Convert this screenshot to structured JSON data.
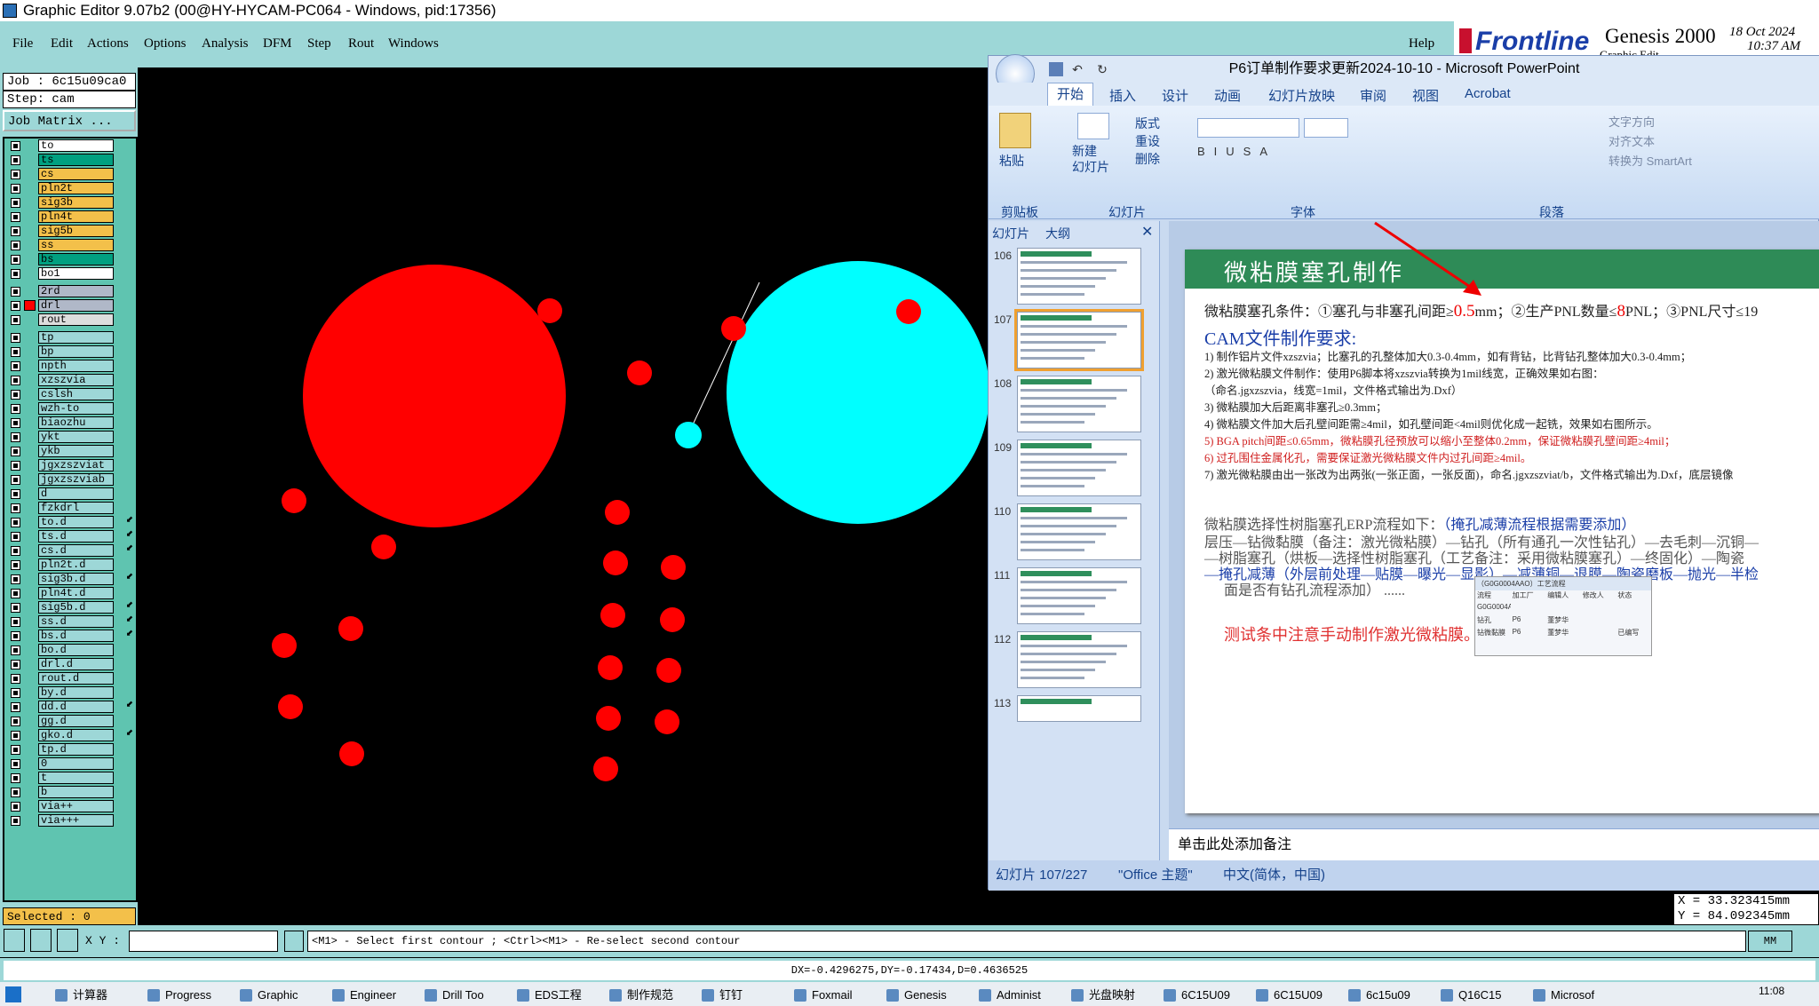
{
  "window": {
    "title": "Graphic Editor 9.07b2 (00@HY-HYCAM-PC064 - Windows, pid:17356)"
  },
  "menubar": {
    "items": [
      "File",
      "Edit",
      "Actions",
      "Options",
      "Analysis",
      "DFM",
      "Step",
      "Rout",
      "Windows"
    ],
    "help": "Help"
  },
  "banner": {
    "brand": "Frontline",
    "product": "Genesis 2000",
    "date": "18 Oct 2024",
    "time": "10:37 AM",
    "subtitle": "Graphic Edit"
  },
  "jobinfo": {
    "job": "Job : 6c15u09ca0",
    "step": "Step: cam",
    "matrix": "Job Matrix ..."
  },
  "layers": [
    {
      "name": "to",
      "color": "#ffffff"
    },
    {
      "name": "ts",
      "color": "#00a080"
    },
    {
      "name": "cs",
      "color": "#f3c04a"
    },
    {
      "name": "pln2t",
      "color": "#f3c04a"
    },
    {
      "name": "sig3b",
      "color": "#f3c04a"
    },
    {
      "name": "pln4t",
      "color": "#f3c04a"
    },
    {
      "name": "sig5b",
      "color": "#f3c04a"
    },
    {
      "name": "ss",
      "color": "#f3c04a"
    },
    {
      "name": "bs",
      "color": "#00a080"
    },
    {
      "name": "bo1",
      "color": "#ffffff"
    },
    {
      "name": "2rd",
      "color": "#b0b8c8"
    },
    {
      "name": "drl",
      "color": "#b0b8c8"
    },
    {
      "name": "rout",
      "color": "#dddddd"
    },
    {
      "name": "tp",
      "color": "#9dd7d7"
    },
    {
      "name": "bp",
      "color": "#9dd7d7"
    },
    {
      "name": "npth",
      "color": "#9dd7d7"
    },
    {
      "name": "xzszvia",
      "color": "#9dd7d7"
    },
    {
      "name": "cslsh",
      "color": "#9dd7d7"
    },
    {
      "name": "wzh-to",
      "color": "#9dd7d7"
    },
    {
      "name": "biaozhu",
      "color": "#9dd7d7"
    },
    {
      "name": "ykt",
      "color": "#9dd7d7"
    },
    {
      "name": "ykb",
      "color": "#9dd7d7"
    },
    {
      "name": "jgxzszviat",
      "color": "#9dd7d7"
    },
    {
      "name": "jgxzszviab",
      "color": "#9dd7d7"
    },
    {
      "name": "d",
      "color": "#9dd7d7"
    },
    {
      "name": "fzkdrl",
      "color": "#9dd7d7"
    },
    {
      "name": "to.d",
      "color": "#9dd7d7"
    },
    {
      "name": "ts.d",
      "color": "#9dd7d7"
    },
    {
      "name": "cs.d",
      "color": "#9dd7d7"
    },
    {
      "name": "pln2t.d",
      "color": "#9dd7d7"
    },
    {
      "name": "sig3b.d",
      "color": "#9dd7d7"
    },
    {
      "name": "pln4t.d",
      "color": "#9dd7d7"
    },
    {
      "name": "sig5b.d",
      "color": "#9dd7d7"
    },
    {
      "name": "ss.d",
      "color": "#9dd7d7"
    },
    {
      "name": "bs.d",
      "color": "#9dd7d7"
    },
    {
      "name": "bo.d",
      "color": "#9dd7d7"
    },
    {
      "name": "drl.d",
      "color": "#9dd7d7"
    },
    {
      "name": "rout.d",
      "color": "#9dd7d7"
    },
    {
      "name": "by.d",
      "color": "#9dd7d7"
    },
    {
      "name": "dd.d",
      "color": "#9dd7d7"
    },
    {
      "name": "gg.d",
      "color": "#9dd7d7"
    },
    {
      "name": "gko.d",
      "color": "#9dd7d7"
    },
    {
      "name": "tp.d",
      "color": "#9dd7d7"
    },
    {
      "name": "0",
      "color": "#9dd7d7"
    },
    {
      "name": "t",
      "color": "#9dd7d7"
    },
    {
      "name": "b",
      "color": "#9dd7d7"
    },
    {
      "name": "via++",
      "color": "#9dd7d7"
    },
    {
      "name": "via+++",
      "color": "#9dd7d7"
    }
  ],
  "selected": "Selected : 0",
  "command": {
    "xy_label": "X Y :",
    "hint": "<M1> - Select first contour ; <Ctrl><M1> - Re-select second contour",
    "unit": "MM"
  },
  "status": {
    "delta": "DX=-0.4296275,DY=-0.17434,D=0.4636525"
  },
  "coords": {
    "x": "X = 33.323415mm",
    "y": "Y = 84.092345mm"
  },
  "ppt": {
    "title": "P6订单制作要求更新2024-10-10 - Microsoft PowerPoint",
    "tabs": [
      "开始",
      "插入",
      "设计",
      "动画",
      "幻灯片放映",
      "审阅",
      "视图",
      "Acrobat"
    ],
    "ribbon": {
      "paste": "粘贴",
      "new_slide": "新建\n幻灯片",
      "layout": "版式",
      "reset": "重设",
      "delete": "删除",
      "text_dir": "文字方向",
      "align_text": "对齐文本",
      "smartart": "转换为 SmartArt",
      "groups": [
        "剪贴板",
        "幻灯片",
        "字体",
        "段落"
      ]
    },
    "pane_tabs": [
      "幻灯片",
      "大纲"
    ],
    "thumbs": [
      "106",
      "107",
      "108",
      "109",
      "110",
      "111",
      "112",
      "113"
    ],
    "slide": {
      "title": "微粘膜塞孔制作",
      "cond_prefix": "微粘膜塞孔条件：①塞孔与非塞孔间距≥",
      "cond_red": "0.5",
      "cond_mid": "mm；②生产PNL数量≤",
      "cond_red2": "8",
      "cond_end": "PNL；③PNL尺寸≤19",
      "cam_title": "CAM文件制作要求:",
      "lines": [
        "1) 制作铝片文件xzszvia；比塞孔的孔整体加大0.3-0.4mm，如有背钻，比背钻孔整体加大0.3-0.4mm；",
        "2) 激光微粘膜文件制作：使用P6脚本将xzszvia转换为1mil线宽，正确效果如右图：",
        "（命名.jgxzszvia，线宽=1mil，文件格式输出为.Dxf）",
        "3) 微粘膜加大后距离非塞孔≥0.3mm；",
        "4) 微粘膜文件加大后孔壁间距需≥4mil，如孔壁间距<4mil则优化成一起铣，效果如右图所示。",
        "5)  BGA pitch间距≤0.65mm，微粘膜孔径预放可以缩小至整体0.2mm，保证微粘膜孔壁间距≥4mil；",
        "6) 过孔围住金属化孔，需要保证激光微粘膜文件内过孔间距≥4mil。",
        "7) 激光微粘膜由出一张改为出两张(一张正面，一张反面)，命名.jgxzszviat/b，文件格式输出为.Dxf，底层镜像"
      ],
      "erp_title": "微粘膜选择性树脂塞孔ERP流程如下：",
      "erp_note": "（掩孔减薄流程根据需要添加）",
      "erp_line1": "层压—钻微黏膜（备注：激光微粘膜）—钻孔（所有通孔一次性钻孔）—去毛刺—沉铜—",
      "erp_line2": "—树脂塞孔（烘板—选择性树脂塞孔（工艺备注：采用微粘膜塞孔）—终固化）—陶瓷",
      "erp_line3": "—掩孔减薄（外层前处理—贴膜—曝光—显影）—减薄铜—退膜—陶瓷磨板—抛光—半检",
      "erp_line4": "面是否有钻孔流程添加） ......",
      "test_note": "测试条中注意手动制作激光微粘膜。",
      "mini_table": {
        "header": [
          "流程",
          "加工厂",
          "编辑人",
          "修改人",
          "状态"
        ],
        "rows": [
          [
            "G0G0004AAO",
            "",
            "",
            "",
            ""
          ],
          [
            "钻孔",
            "P6",
            "董梦华",
            "",
            ""
          ],
          [
            "钻微黏膜",
            "P6",
            "董梦华",
            "",
            "已编写"
          ]
        ],
        "title": "（G0G0004AAO）工艺流程"
      }
    },
    "notes": "单击此处添加备注",
    "statusbar": {
      "slide": "幻灯片 107/227",
      "theme": "\"Office 主题\"",
      "lang": "中文(简体，中国)"
    }
  },
  "taskbar": {
    "items": [
      "计算器",
      "Progress",
      "Graphic",
      "Engineer",
      "Drill Too",
      "EDS工程",
      "制作规范",
      "钉钉",
      "Foxmail",
      "Genesis",
      "Administ",
      "光盘映射",
      "6C15U09",
      "6C15U09",
      "6c15u09",
      "Q16C15",
      "Microsof"
    ],
    "time": "11:08"
  }
}
